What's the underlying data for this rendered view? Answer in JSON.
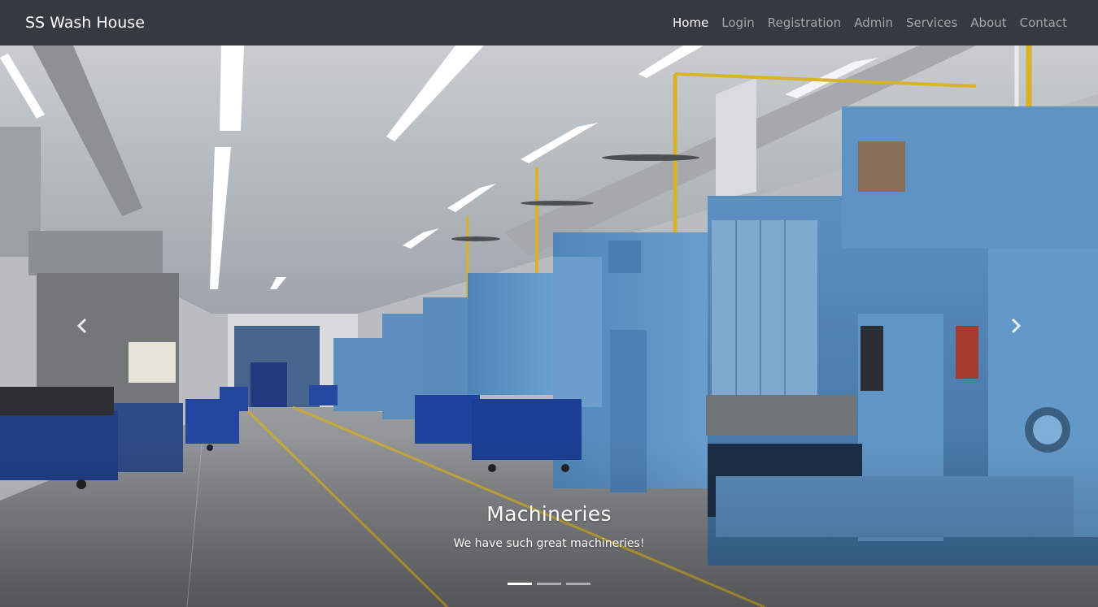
{
  "navbar": {
    "brand": "SS Wash House",
    "items": [
      {
        "label": "Home",
        "active": true
      },
      {
        "label": "Login"
      },
      {
        "label": "Registration"
      },
      {
        "label": "Admin"
      },
      {
        "label": "Services"
      },
      {
        "label": "About"
      },
      {
        "label": "Contact"
      }
    ]
  },
  "carousel": {
    "slide": {
      "title": "Machineries",
      "subtitle": "We have such great machineries!"
    },
    "indicator_count": 3,
    "active_indicator": 0,
    "prev_icon": "chevron-left-icon",
    "next_icon": "chevron-right-icon"
  },
  "colors": {
    "navbar_bg": "#343a40",
    "machine_blue": "#5e93c2",
    "bin_blue": "#1f3f8f"
  }
}
